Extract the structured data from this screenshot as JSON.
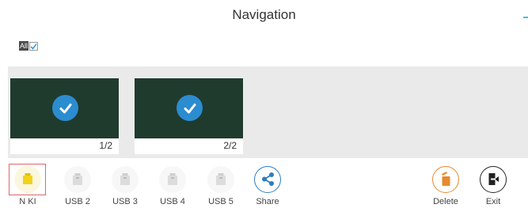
{
  "header": {
    "title": "Navigation"
  },
  "select_all": {
    "label": "All",
    "checked": true
  },
  "thumbnails": [
    {
      "page": "1/2",
      "selected": true
    },
    {
      "page": "2/2",
      "selected": true
    }
  ],
  "toolbar": {
    "sources": [
      {
        "label": "N KI",
        "icon": "usb-drive-icon",
        "active": true,
        "color": "#f3d21a"
      },
      {
        "label": "USB 2",
        "icon": "usb-drive-icon",
        "active": false
      },
      {
        "label": "USB 3",
        "icon": "usb-drive-icon",
        "active": false
      },
      {
        "label": "USB 4",
        "icon": "usb-drive-icon",
        "active": false
      },
      {
        "label": "USB 5",
        "icon": "usb-drive-icon",
        "active": false
      }
    ],
    "share": {
      "label": "Share",
      "icon": "share-icon",
      "color": "#2c7cc1"
    },
    "delete": {
      "label": "Delete",
      "icon": "trash-icon",
      "color": "#e58a2e"
    },
    "exit": {
      "label": "Exit",
      "icon": "exit-icon",
      "color": "#222222"
    }
  },
  "colors": {
    "accent": "#3fc1d9",
    "check_blue": "#2c8cd0",
    "thumb_bg": "#1f3b2e",
    "active_border": "#e06666"
  }
}
